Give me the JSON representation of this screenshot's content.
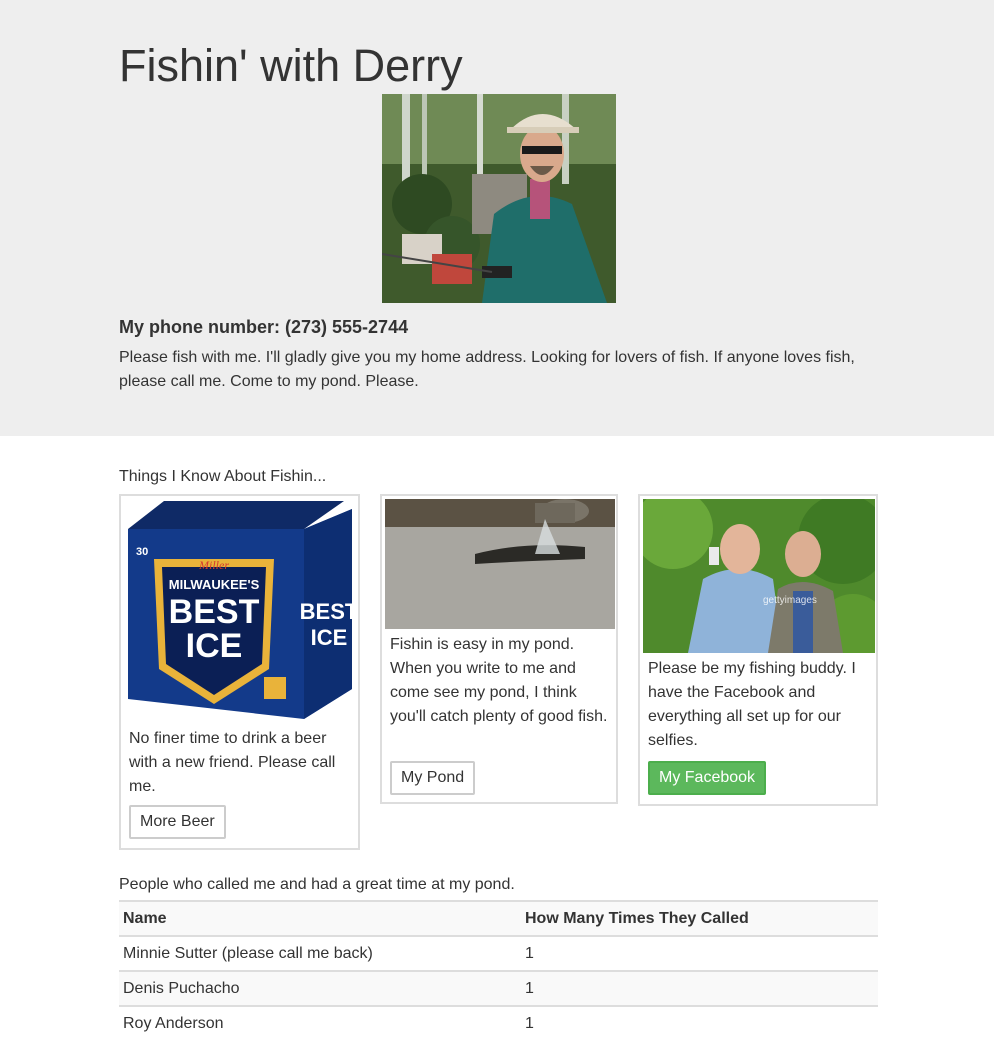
{
  "header": {
    "title": "Fishin' with Derry",
    "phone": "My phone number: (273) 555-2744",
    "plea": "Please fish with me. I'll gladly give you my home address. Looking for lovers of fish. If anyone loves fish, please call me. Come to my pond. Please."
  },
  "things": {
    "heading": "Things I Know About Fishin...",
    "cards": [
      {
        "caption": "No finer time to drink a beer with a new friend. Please call me.",
        "button": "More Beer",
        "image_label_brand": "Miller",
        "image_label_top": "MILWAUKEE'S",
        "image_label_main1": "BEST",
        "image_label_main2": "ICE",
        "image_label_count": "30"
      },
      {
        "caption": "Fishin is easy in my pond. When you write to me and come see my pond, I think you'll catch plenty of good fish.",
        "button": "My Pond"
      },
      {
        "caption": "Please be my fishing buddy. I have the Facebook and everything all set up for our selfies.",
        "button": "My Facebook",
        "image_watermark": "gettyimages"
      }
    ]
  },
  "callers": {
    "heading": "People who called me and had a great time at my pond.",
    "columns": [
      "Name",
      "How Many Times They Called"
    ],
    "rows": [
      [
        "Minnie Sutter (please call me back)",
        "1"
      ],
      [
        "Denis Puchacho",
        "1"
      ],
      [
        "Roy Anderson",
        "1"
      ]
    ]
  },
  "colors": {
    "jumbotron_bg": "#eeeeee",
    "success_button": "#5cb85c"
  }
}
